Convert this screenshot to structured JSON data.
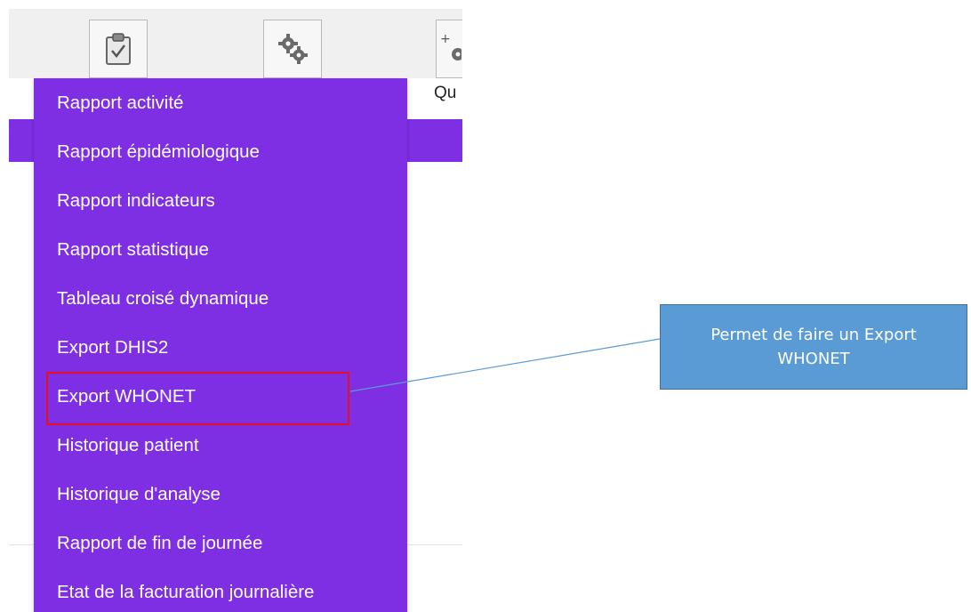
{
  "toolbar": {
    "buttons": [
      {
        "icon": "clipboard-check-icon"
      },
      {
        "icon": "gears-icon"
      },
      {
        "icon": "gear-plus-icon"
      }
    ],
    "partial_label": "Qu"
  },
  "menu": {
    "items": [
      "Rapport activité",
      "Rapport épidémiologique",
      "Rapport indicateurs",
      "Rapport statistique",
      "Tableau croisé dynamique",
      "Export DHIS2",
      "Export WHONET",
      "Historique patient",
      "Historique d'analyse",
      "Rapport de fin de journée",
      "Etat de la facturation journalière"
    ],
    "highlighted_item": "Export WHONET"
  },
  "annotation": {
    "callout_text": "Permet de faire un Export WHONET"
  },
  "colors": {
    "menu_background": "#7e2fe4",
    "highlight_border": "#e8101e",
    "callout_fill": "#5b9bd5",
    "connector_line": "#5b9bd5"
  }
}
